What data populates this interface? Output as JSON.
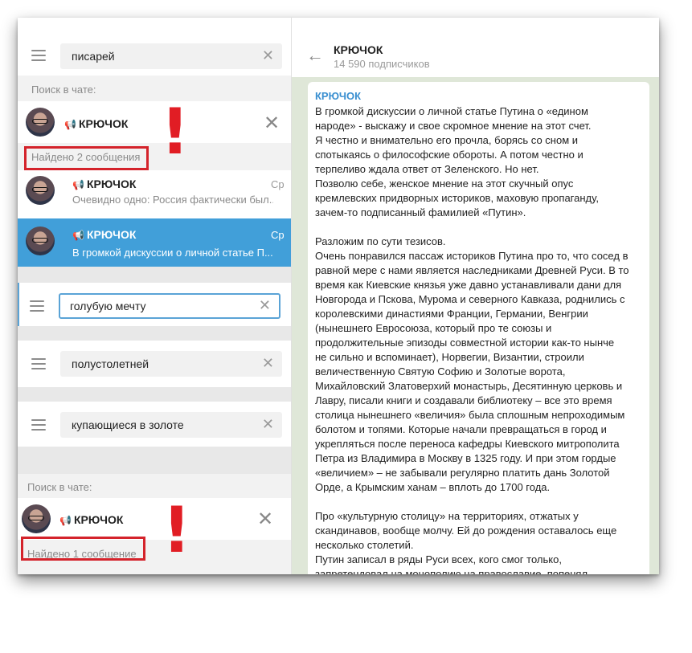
{
  "left": {
    "search1": {
      "value": "писарей"
    },
    "chat_search_label": "Поиск в чате:",
    "channel1": {
      "name": "КРЮЧОК"
    },
    "found1": "Найдено 2 сообщения",
    "results": [
      {
        "name": "КРЮЧОК",
        "date": "Ср",
        "preview": "Очевидно одно: Россия фактически был..."
      },
      {
        "name": "КРЮЧОК",
        "date": "Ср",
        "preview": "В громкой дискуссии о личной статье П..."
      }
    ],
    "search2": {
      "value": "голубую мечту"
    },
    "search3": {
      "value": "полустолетней"
    },
    "search4": {
      "value": "купающиеся в золоте"
    },
    "chat_search_label2": "Поиск в чате:",
    "channel2": {
      "name": "КРЮЧОК"
    },
    "found2": "Найдено 1 сообщение",
    "exclamation": "!"
  },
  "right": {
    "title": "КРЮЧОК",
    "subscribers": "14 590 подписчиков",
    "message": {
      "author": "КРЮЧОК",
      "text": "В громкой дискуссии о личной статье Путина о «едином\nнароде» - выскажу и свое скромное мнение на этот счет.\nЯ честно и внимательно его прочла, борясь со сном и\nспотыкаясь о философские обороты. А потом честно и\nтерпеливо ждала ответ от Зеленского. Но нет.\nПозволю себе, женское мнение на этот скучный опус\nкремлевских придворных историков, маховую пропаганду,\nзачем-то подписанный фамилией «Путин».\n\nРазложим по сути тезисов.\nОчень понравился пассаж историков Путина про то, что сосед в\nравной мере с нами является наследниками Древней Руси. В то\nвремя как Киевские князья уже давно устанавливали дани для\nНовгорода и Пскова, Мурома и северного Кавказа, роднились с\nкоролевскими династиями Франции, Германии, Венгрии\n(нынешнего Евросоюза, который про те союзы и\nпродолжительные эпизоды совместной истории как-то нынче\nне сильно и вспоминает), Норвегии, Византии, строили\nвеличественную Святую Софию и Золотые ворота,\nМихайловский Златоверхий монастырь, Десятинную церковь и\nЛавру, писали книги и создавали библиотеку – все это время\nстолица нынешнего «величия» была сплошным непроходимым\nболотом и топями. Которые начали превращаться в город и\nукрепляться после переноса кафедры Киевского митрополита\nПетра из Владимира в Москву в 1325 году. И при этом гордые\n«величием» – не забывали регулярно платить дань Золотой\nОрде, а Крымским ханам – вплоть до 1700 года.\n\nПро «культурную столицу» на территориях, отжатых у\nскандинавов, вообще молчу. Ей до рождения оставалось еще\nнесколько столетий.\nПутин записал в ряды Руси всех, кого смог только,\nзапретендовал на монополию на православие, попенял"
    }
  }
}
